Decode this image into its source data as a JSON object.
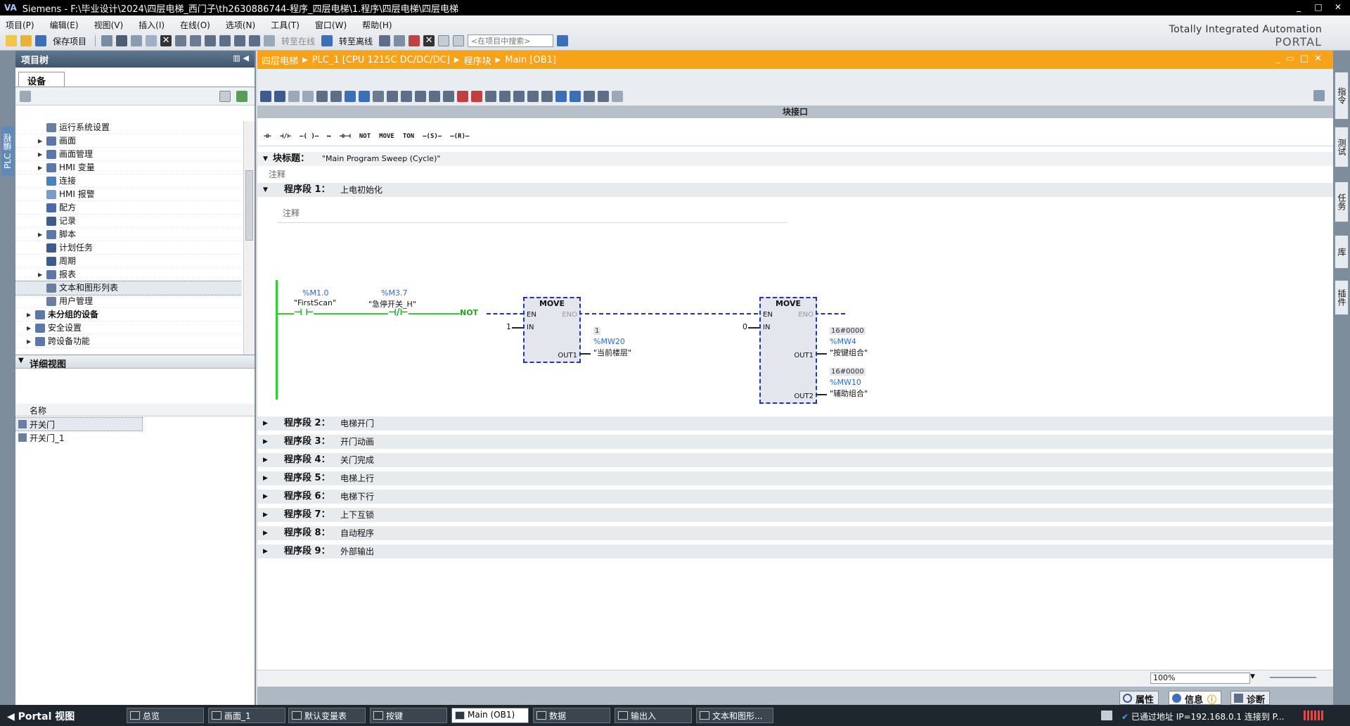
{
  "window": {
    "logo": "VA",
    "title": "Siemens  -  F:\\毕业设计\\2024\\四层电梯_西门子\\th2630886744-程序_四层电梯\\1.程序\\四层电梯\\四层电梯",
    "controls": [
      "_",
      "□",
      "✕"
    ]
  },
  "menu": [
    "项目(P)",
    "编辑(E)",
    "视图(V)",
    "插入(I)",
    "在线(O)",
    "选项(N)",
    "工具(T)",
    "窗口(W)",
    "帮助(H)"
  ],
  "toolbar": {
    "save_label": "保存项目",
    "go_online": "转至在线",
    "go_offline": "转至离线",
    "search_placeholder": "<在项目中搜索>"
  },
  "brand": {
    "line1": "Totally Integrated Automation",
    "line2": "PORTAL"
  },
  "left_strip": {
    "label": "PLC 编程"
  },
  "project_tree": {
    "title": "项目树",
    "tab": "设备",
    "items": [
      {
        "label": "运行系统设置",
        "indent": 2,
        "expand": false,
        "icon": "settings-icon",
        "color": "#6a7fa0"
      },
      {
        "label": "画面",
        "indent": 2,
        "expand": true,
        "icon": "folder-icon",
        "color": "#5b78a8"
      },
      {
        "label": "画面管理",
        "indent": 2,
        "expand": true,
        "icon": "folder-icon",
        "color": "#5b78a8"
      },
      {
        "label": "HMI 变量",
        "indent": 2,
        "expand": true,
        "icon": "tag-icon",
        "color": "#5b78a8"
      },
      {
        "label": "连接",
        "indent": 2,
        "expand": false,
        "icon": "connection-icon",
        "color": "#4a7fc1"
      },
      {
        "label": "HMI 报警",
        "indent": 2,
        "expand": false,
        "icon": "alarm-icon",
        "color": "#7c9bc8"
      },
      {
        "label": "配方",
        "indent": 2,
        "expand": false,
        "icon": "recipe-icon",
        "color": "#4a69a8"
      },
      {
        "label": "记录",
        "indent": 2,
        "expand": false,
        "icon": "log-icon",
        "color": "#3d5c8c"
      },
      {
        "label": "脚本",
        "indent": 2,
        "expand": true,
        "icon": "folder-icon",
        "color": "#5b78a8"
      },
      {
        "label": "计划任务",
        "indent": 2,
        "expand": false,
        "icon": "schedule-icon",
        "color": "#3d5c8c"
      },
      {
        "label": "周期",
        "indent": 2,
        "expand": false,
        "icon": "cycle-icon",
        "color": "#3d5c8c"
      },
      {
        "label": "报表",
        "indent": 2,
        "expand": true,
        "icon": "folder-icon",
        "color": "#5b78a8"
      },
      {
        "label": "文本和图形列表",
        "indent": 2,
        "expand": false,
        "icon": "textlist-icon",
        "color": "#6a7fa0",
        "selected": true
      },
      {
        "label": "用户管理",
        "indent": 2,
        "expand": false,
        "icon": "user-icon",
        "color": "#6a7fa0"
      },
      {
        "label": "未分组的设备",
        "indent": 1,
        "expand": true,
        "icon": "device-folder-icon",
        "color": "#5b78a8",
        "bold": true
      },
      {
        "label": "安全设置",
        "indent": 1,
        "expand": true,
        "icon": "security-icon",
        "color": "#5b78a8"
      },
      {
        "label": "跨设备功能",
        "indent": 1,
        "expand": true,
        "icon": "cross-device-icon",
        "color": "#5b78a8"
      }
    ]
  },
  "detail_view": {
    "title": "详细视图",
    "column": "名称",
    "rows": [
      "开关门",
      "开关门_1"
    ]
  },
  "editor": {
    "breadcrumb": [
      "四层电梯",
      "PLC_1 [CPU 1215C DC/DC/DC]",
      "程序块",
      "Main [OB1]"
    ],
    "interface_label": "块接口",
    "instructions": [
      "⊣⊢",
      "⊣/⊢",
      "–( )–",
      "↦",
      "⊣⊢⊣",
      "NOT",
      "MOVE",
      "TON",
      "–(S)–",
      "–(R)–"
    ],
    "block_title_label": "块标题：",
    "block_title": "\"Main Program Sweep (Cycle)\"",
    "comment": "注释",
    "network1": {
      "name": "程序段 1：",
      "title": "上电初始化",
      "contact1": {
        "addr": "%M1.0",
        "name": "\"FirstScan\""
      },
      "contact2": {
        "addr": "%M3.7",
        "name": "\"急停开关_H\""
      },
      "not_label": "NOT",
      "move1": {
        "title": "MOVE",
        "en": "EN",
        "eno": "ENO",
        "in": "IN",
        "in_val": "1",
        "out": "OUT1",
        "out_val": "1",
        "out_addr": "%MW20",
        "out_name": "\"当前楼层\""
      },
      "move2": {
        "title": "MOVE",
        "en": "EN",
        "eno": "ENO",
        "in": "IN",
        "in_val": "0",
        "out1": "OUT1",
        "out1_val": "16#0000",
        "out1_addr": "%MW4",
        "out1_name": "\"按键组合\"",
        "out2": "OUT2",
        "out2_val": "16#0000",
        "out2_addr": "%MW10",
        "out2_name": "\"辅助组合\""
      }
    },
    "networks": [
      {
        "name": "程序段 2：",
        "title": "电梯开门"
      },
      {
        "name": "程序段 3：",
        "title": "开门动画"
      },
      {
        "name": "程序段 4：",
        "title": "关门完成"
      },
      {
        "name": "程序段 5：",
        "title": "电梯上行"
      },
      {
        "name": "程序段 6：",
        "title": "电梯下行"
      },
      {
        "name": "程序段 7：",
        "title": "上下互锁"
      },
      {
        "name": "程序段 8：",
        "title": "自动程序"
      },
      {
        "name": "程序段 9：",
        "title": "外部输出"
      }
    ],
    "zoom": "100%"
  },
  "right_tabs": [
    "指令",
    "测试",
    "任务",
    "库",
    "插件"
  ],
  "inspector_tabs": [
    "属性",
    "信息",
    "诊断"
  ],
  "taskbar": {
    "portal": "Portal 视图",
    "tasks": [
      "总览",
      "画面_1",
      "默认变量表",
      "按键",
      "Main (OB1)",
      "数据",
      "输出入",
      "文本和图形..."
    ],
    "status": "已通过地址 IP=192.168.0.1 连接到 P..."
  }
}
